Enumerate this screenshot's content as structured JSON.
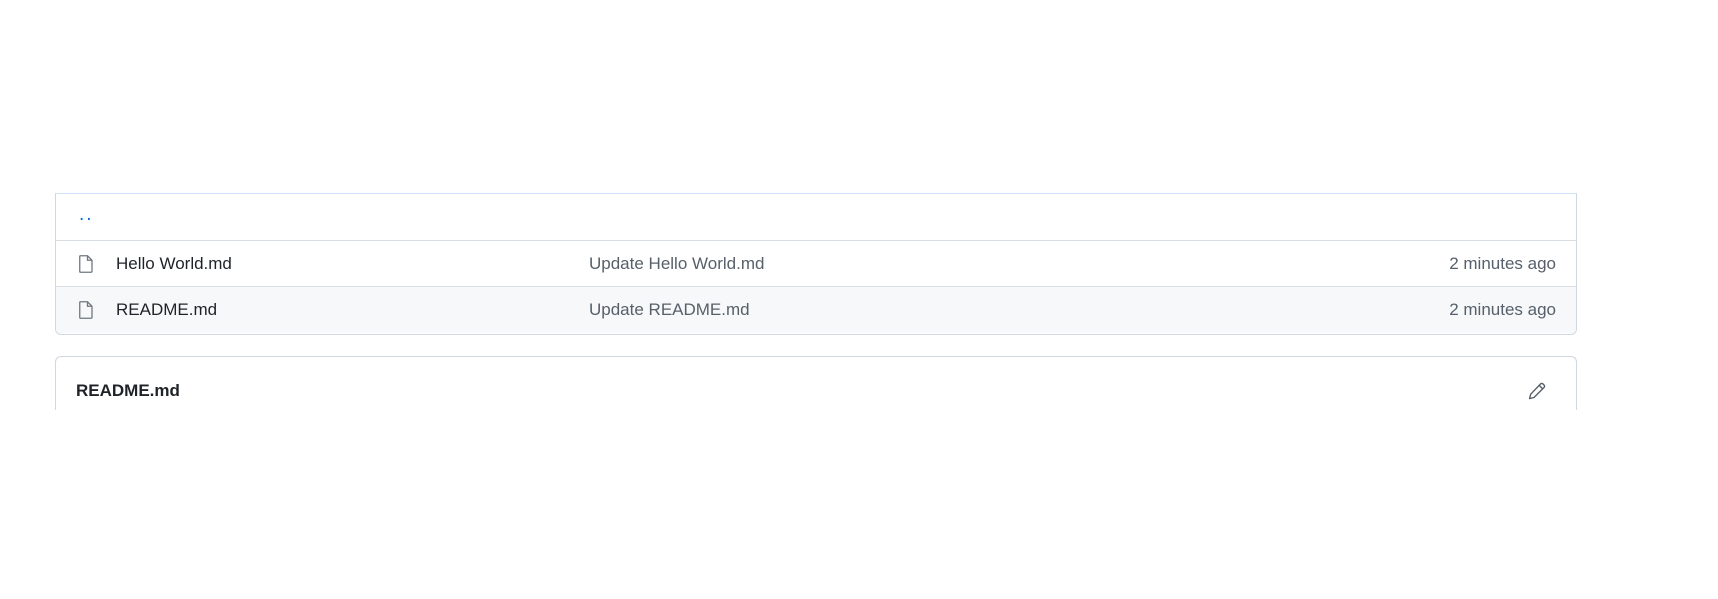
{
  "file_list": {
    "parent_link": "..",
    "rows": [
      {
        "icon": "file-icon",
        "name": "Hello World.md",
        "commit_message": "Update Hello World.md",
        "updated": "2 minutes ago"
      },
      {
        "icon": "file-icon",
        "name": "README.md",
        "commit_message": "Update README.md",
        "updated": "2 minutes ago"
      }
    ]
  },
  "readme": {
    "title": "README.md",
    "edit_icon": "pencil-icon"
  },
  "colors": {
    "link": "#0969da",
    "border": "#d0d7de",
    "muted_text": "#57606a",
    "row_highlight": "#f6f8fa"
  }
}
